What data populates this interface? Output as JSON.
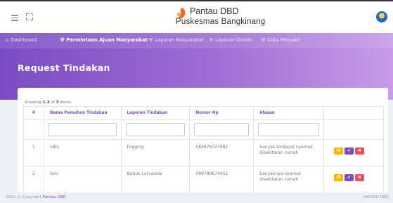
{
  "app": {
    "title": "Pantau DBD",
    "subtitle": "Puskesmas Bangkinang"
  },
  "nav": {
    "items": [
      {
        "label": "Dashboard",
        "icon": "home-icon"
      },
      {
        "label": "Permintaan Ajuan Masyarakat",
        "icon": "shield-icon",
        "active": true
      },
      {
        "label": "Laporan Masyarakat",
        "icon": "shield-icon"
      },
      {
        "label": "Laporan Dinkes",
        "icon": "shield-icon"
      },
      {
        "label": "Data Penyakit",
        "icon": "shield-icon"
      }
    ]
  },
  "page": {
    "title": "Request Tindakan"
  },
  "summary": {
    "prefix": "Showing",
    "range": "1-3",
    "of": "of",
    "total": "3",
    "suffix": "items."
  },
  "table": {
    "headers": [
      "#",
      "Nama Pemohon Tindakan",
      "Laporan Tindakan",
      "Nomor Hp",
      "Alasan",
      ""
    ],
    "rows": [
      {
        "no": "1",
        "nama": "udin",
        "laporan": "Fogging",
        "hp": "084678727882",
        "alasan": "banyak terdapat nyamuk disekitaran rumah"
      },
      {
        "no": "2",
        "nama": "toni",
        "laporan": "Bubuk Larvasida",
        "hp": "099789674452",
        "alasan": "banyaknya nyamuk disekitaran rumah"
      }
    ]
  },
  "actions": {
    "view": "👁",
    "approve": "✔",
    "delete": "✖"
  },
  "footer": {
    "copyright_prefix": "2022 © Copyright",
    "copyright_brand": "Pantau DBD",
    "right": "PANTAU DBD"
  },
  "colors": {
    "accent": "#7b4cc4",
    "warning": "#f7b500",
    "danger": "#ee4d5a",
    "header_gradient_start": "#7b4cc4",
    "header_gradient_end": "#c79be8"
  }
}
